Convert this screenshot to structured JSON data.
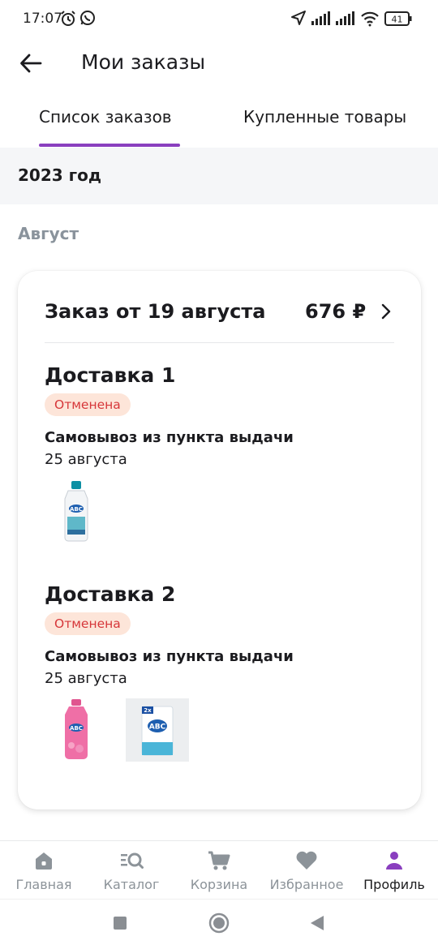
{
  "status_bar": {
    "time": "17:07",
    "battery": "41",
    "icons": [
      "alarm-icon",
      "whatsapp-icon",
      "location-arrow-icon",
      "signal-icon",
      "signal-icon",
      "wifi-icon",
      "battery-icon"
    ]
  },
  "header": {
    "title": "Мои заказы",
    "back_icon": "arrow-left-icon"
  },
  "tabs": [
    {
      "label": "Список заказов",
      "active": true
    },
    {
      "label": "Купленные товары",
      "active": false
    }
  ],
  "year": "2023 год",
  "month": "Август",
  "order": {
    "title": "Заказ от 19 августа",
    "price": "676 ₽",
    "deliveries": [
      {
        "title": "Доставка 1",
        "status": "Отменена",
        "method": "Самовывоз из пункта выдачи",
        "date": "25 августа",
        "products": [
          "abc-white-bottle"
        ]
      },
      {
        "title": "Доставка 2",
        "status": "Отменена",
        "method": "Самовывоз из пункта выдачи",
        "date": "25 августа",
        "products": [
          "abc-pink-bottle",
          "abc-powder-bag"
        ]
      }
    ]
  },
  "bottom_nav": [
    {
      "label": "Главная",
      "icon": "home-icon",
      "active": false
    },
    {
      "label": "Каталог",
      "icon": "catalog-search-icon",
      "active": false
    },
    {
      "label": "Корзина",
      "icon": "cart-icon",
      "active": false
    },
    {
      "label": "Избранное",
      "icon": "heart-icon",
      "active": false
    },
    {
      "label": "Профиль",
      "icon": "profile-icon",
      "active": true
    }
  ],
  "colors": {
    "accent": "#8a3fbf",
    "badge_bg": "#fde5d9",
    "badge_text": "#d6373a",
    "muted": "#8c9399"
  }
}
